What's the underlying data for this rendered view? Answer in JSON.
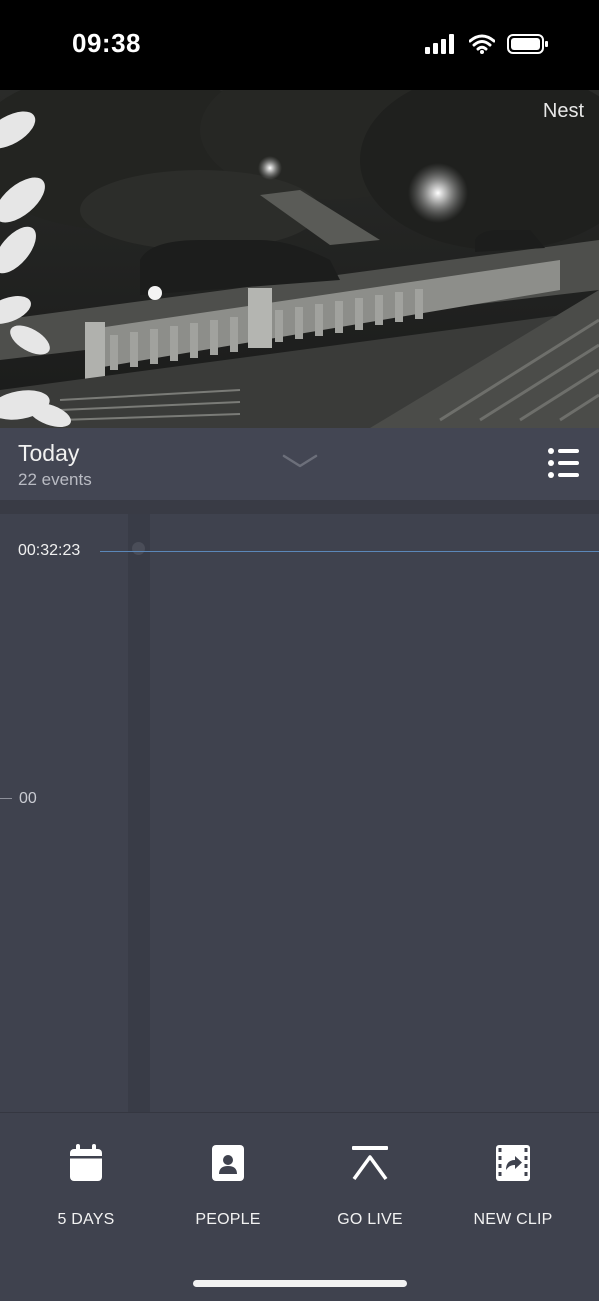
{
  "status_bar": {
    "time": "09:38"
  },
  "camera": {
    "brand_label": "Nest"
  },
  "header": {
    "title": "Today",
    "subtitle": "22 events"
  },
  "timeline": {
    "current_time": "00:32:23",
    "tick_label": "00"
  },
  "toolbar": {
    "items": [
      {
        "label": "5 DAYS",
        "icon": "calendar-icon"
      },
      {
        "label": "PEOPLE",
        "icon": "person-badge-icon"
      },
      {
        "label": "GO LIVE",
        "icon": "go-live-icon"
      },
      {
        "label": "NEW CLIP",
        "icon": "film-clip-icon"
      }
    ]
  },
  "colors": {
    "background": "#3f424e",
    "header": "#434653",
    "playhead": "#5b87b8"
  }
}
